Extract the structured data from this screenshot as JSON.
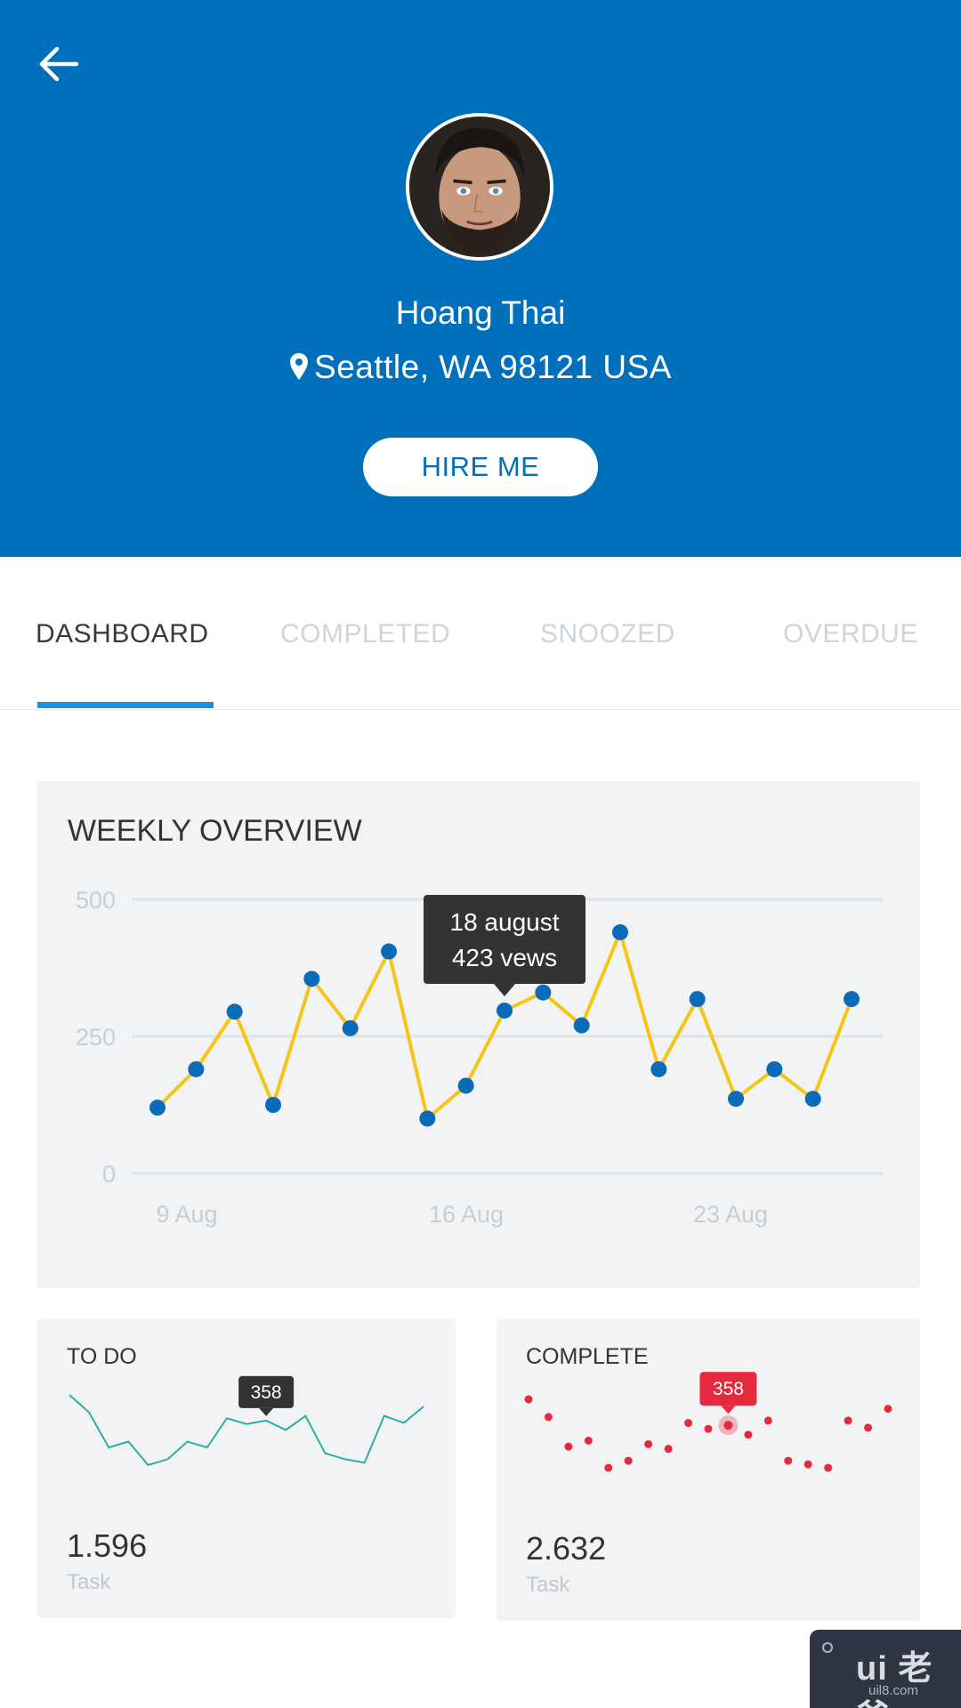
{
  "profile": {
    "name": "Hoang Thai",
    "location": "Seattle, WA 98121 USA",
    "hire_label": "HIRE ME"
  },
  "tabs": [
    {
      "label": "DASHBOARD",
      "active": true
    },
    {
      "label": "COMPLETED",
      "active": false
    },
    {
      "label": "SNOOZED",
      "active": false
    },
    {
      "label": "OVERDUE",
      "active": false
    }
  ],
  "colors": {
    "header": "#0070bd",
    "accent_tab": "#1c8fdd",
    "line": "#f5c518",
    "points": "#0a6cb8",
    "todo_line": "#2bb0a0",
    "complete_points": "#e62a3d"
  },
  "weekly": {
    "title": "WEEKLY OVERVIEW",
    "tooltip": {
      "line1": "18 august",
      "line2": "423 vews"
    }
  },
  "todo": {
    "title": "TO DO",
    "value": "1.596",
    "label": "Task",
    "tooltip": "358"
  },
  "complete": {
    "title": "COMPLETE",
    "value": "2.632",
    "label": "Task",
    "tooltip": "358"
  },
  "watermark": {
    "logo": "ui 老爸",
    "url": "uil8.com"
  },
  "chart_data": [
    {
      "type": "line",
      "title": "WEEKLY OVERVIEW",
      "y_ticks": [
        "500",
        "250",
        "0"
      ],
      "x_tick_labels": [
        "9 Aug",
        "16 Aug",
        "23 Aug"
      ],
      "ylim": [
        0,
        500
      ],
      "grid": true,
      "x": [
        7,
        8,
        9,
        10,
        11,
        12,
        13,
        14,
        15,
        16,
        17,
        18,
        19,
        20,
        21,
        22,
        23,
        24,
        25,
        26
      ],
      "values": [
        120,
        190,
        295,
        125,
        355,
        265,
        405,
        100,
        160,
        297,
        330,
        270,
        440,
        190,
        318,
        136,
        190,
        136,
        318
      ],
      "x_positions_note": "",
      "series": [
        {
          "values": [
            120,
            190,
            295,
            125,
            355,
            265,
            405,
            100,
            160,
            297,
            330,
            270,
            440,
            190,
            318,
            136,
            190,
            136,
            318
          ]
        }
      ]
    },
    {
      "type": "line",
      "title": "TO DO",
      "values": [
        70,
        55,
        25,
        30,
        10,
        15,
        30,
        25,
        50,
        45,
        48,
        40,
        52,
        20,
        15,
        12,
        52,
        46,
        60
      ]
    },
    {
      "type": "scatter",
      "title": "COMPLETE",
      "values": [
        70,
        55,
        30,
        35,
        12,
        18,
        32,
        28,
        50,
        45,
        48,
        40,
        52,
        18,
        15,
        12,
        52,
        46,
        62
      ]
    }
  ]
}
